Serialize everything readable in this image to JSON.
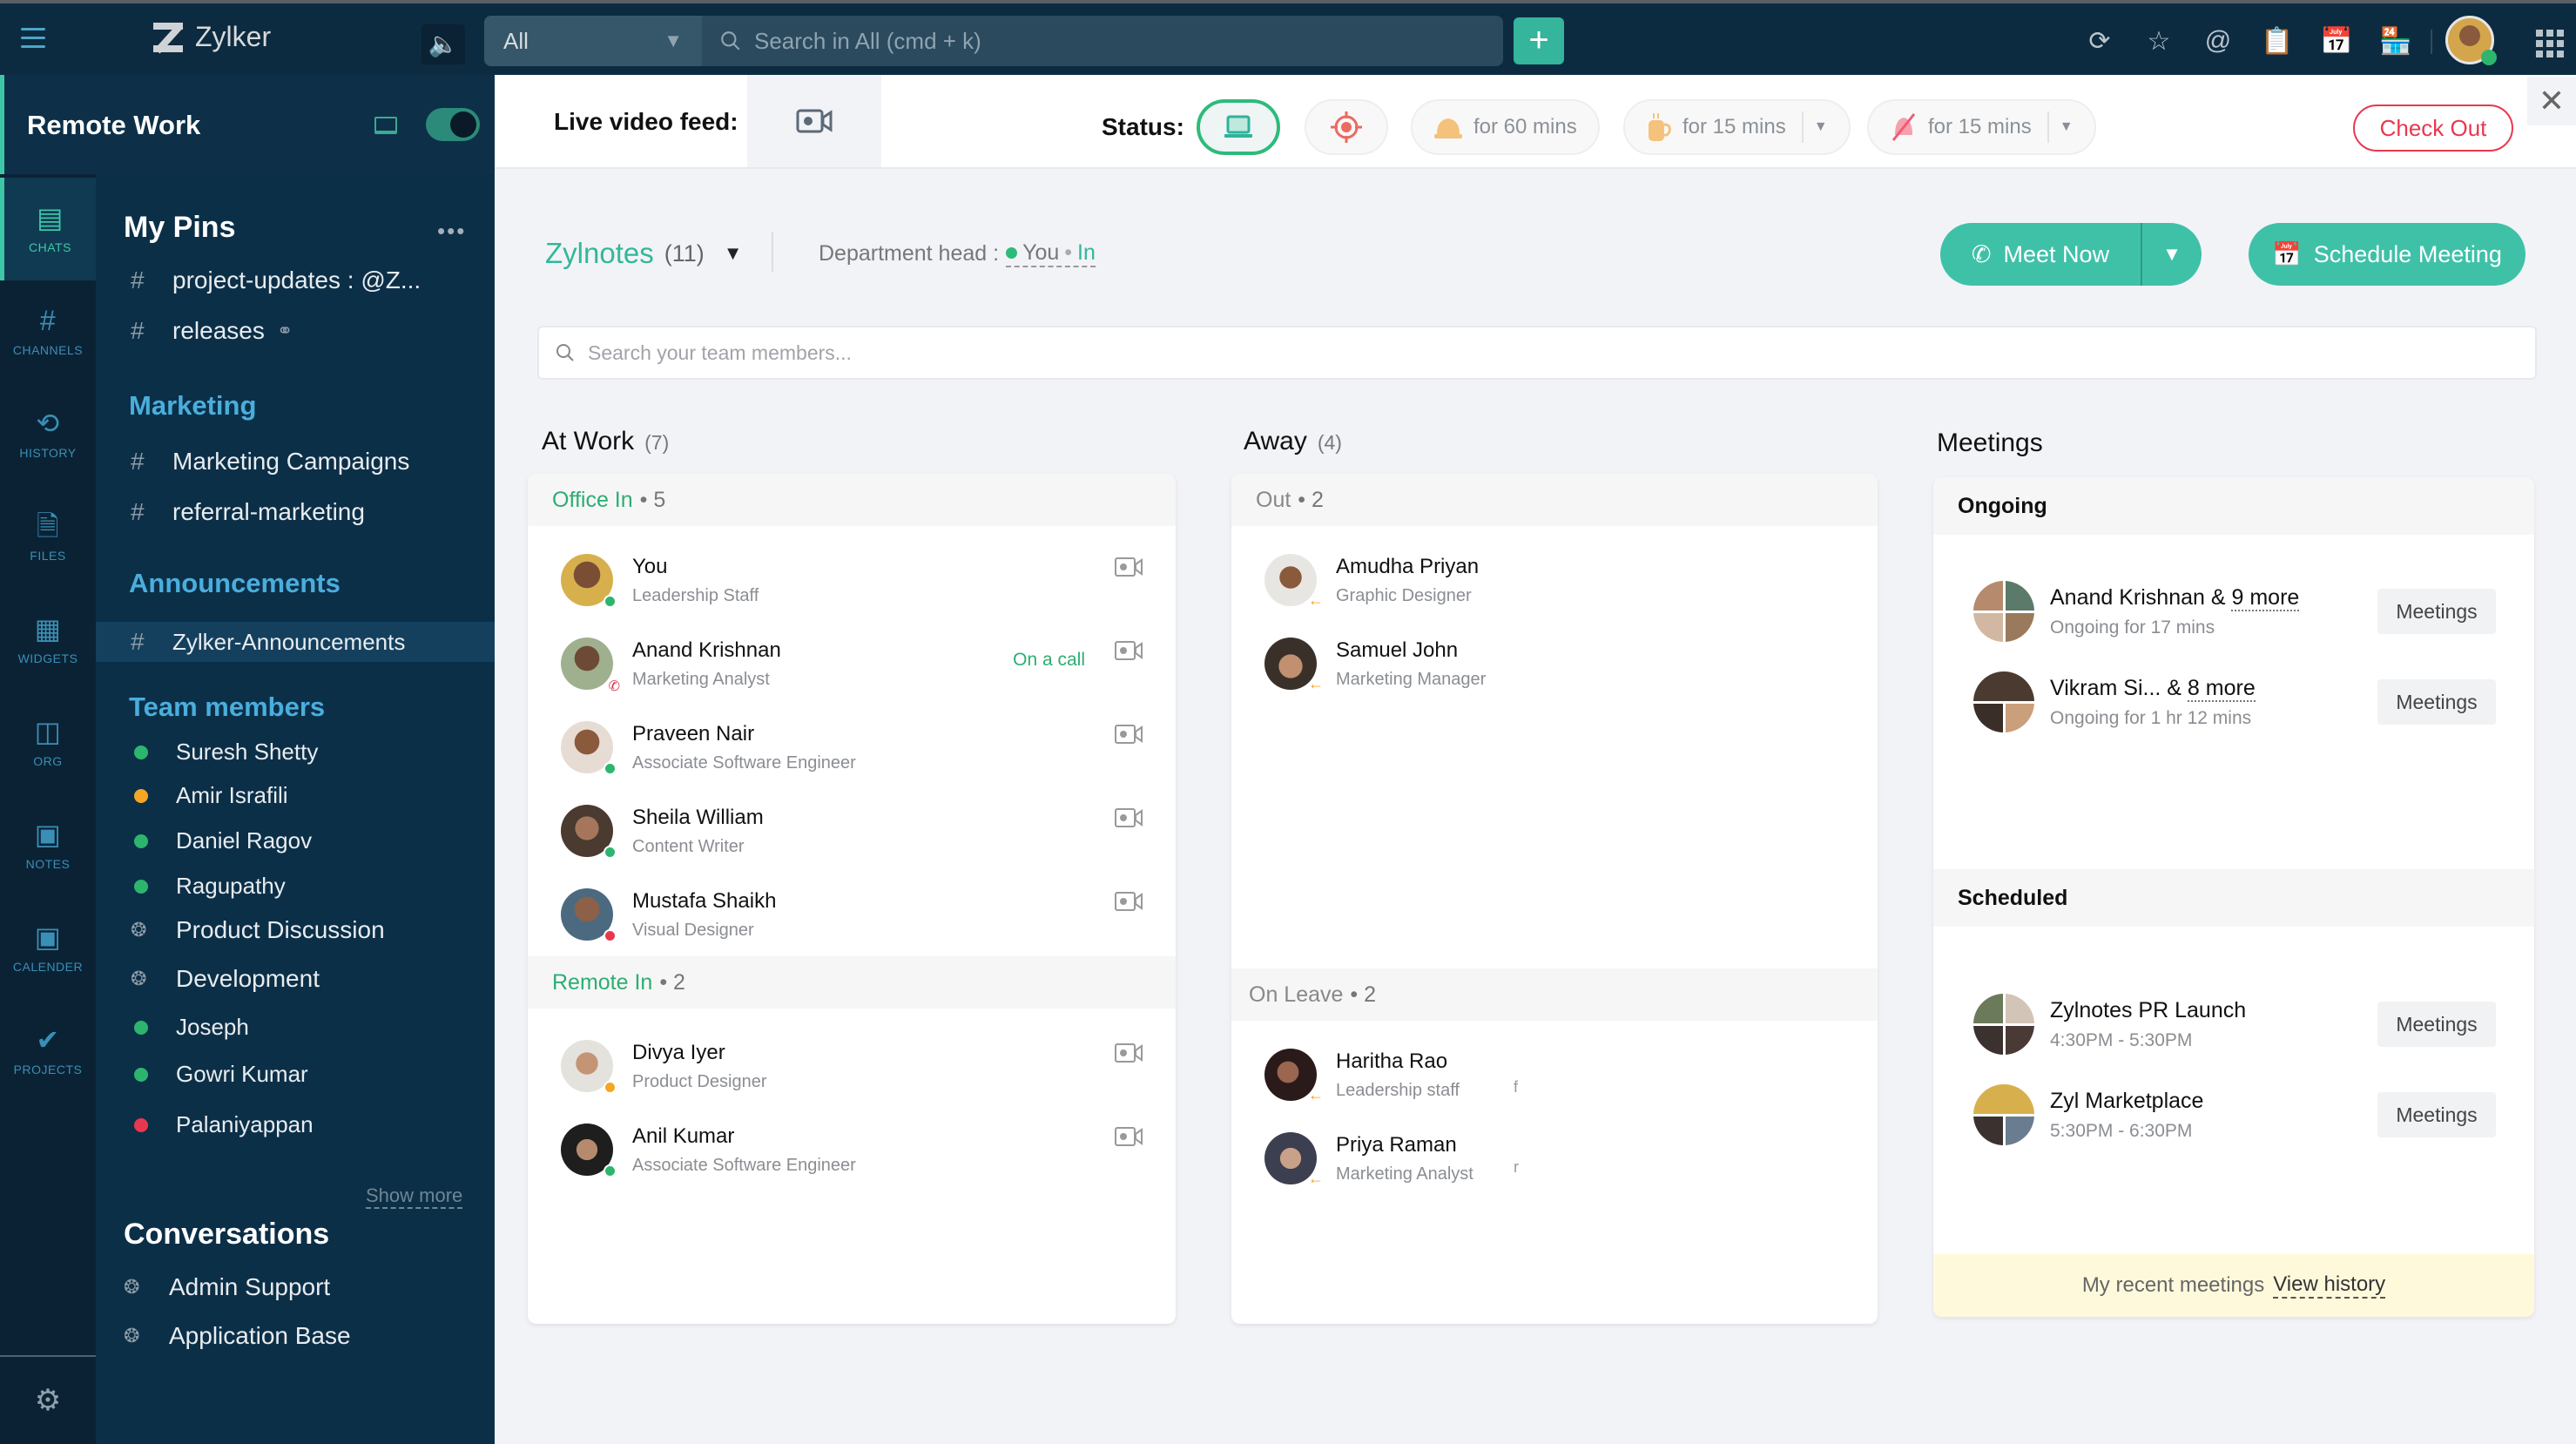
{
  "app": {
    "name": "Zylker",
    "search_scope": "All",
    "search_placeholder": "Search in All (cmd + k)",
    "top_icons": [
      "refresh-clock-icon",
      "star-icon",
      "mention-icon",
      "clipboard-clock-icon",
      "calendar-icon",
      "store-icon"
    ]
  },
  "rail": {
    "header_title": "Remote Work",
    "items": [
      {
        "label": "CHATS",
        "icon": "chat-icon",
        "active": true
      },
      {
        "label": "CHANNELS",
        "icon": "hash-icon"
      },
      {
        "label": "HISTORY",
        "icon": "history-icon"
      },
      {
        "label": "FILES",
        "icon": "file-icon"
      },
      {
        "label": "WIDGETS",
        "icon": "widgets-icon"
      },
      {
        "label": "ORG",
        "icon": "org-icon"
      },
      {
        "label": "NOTES",
        "icon": "notes-icon"
      },
      {
        "label": "CALENDER",
        "icon": "calendar-icon"
      },
      {
        "label": "PROJECTS",
        "icon": "projects-icon"
      }
    ]
  },
  "sidebar": {
    "pins_title": "My Pins",
    "more": "•••",
    "pins": [
      {
        "label": "project-updates : @Z..."
      },
      {
        "label": "releases"
      }
    ],
    "marketing_title": "Marketing",
    "marketing": [
      {
        "label": "Marketing Campaigns"
      },
      {
        "label": "referral-marketing"
      }
    ],
    "announcements_title": "Announcements",
    "announcements": [
      {
        "label": "Zylker-Announcements"
      }
    ],
    "team_title": "Team members",
    "team": [
      {
        "label": "Suresh Shetty",
        "status": "online"
      },
      {
        "label": "Amir Israfili",
        "status": "away"
      },
      {
        "label": "Daniel Ragov",
        "status": "online"
      },
      {
        "label": "Ragupathy",
        "status": "online"
      },
      {
        "label": "Product Discussion",
        "status": "group"
      },
      {
        "label": "Development",
        "status": "group"
      },
      {
        "label": "Joseph",
        "status": "online"
      },
      {
        "label": "Gowri Kumar",
        "status": "online"
      },
      {
        "label": "Palaniyappan",
        "status": "busy"
      }
    ],
    "show_more": "Show more",
    "conversations_title": "Conversations",
    "conversations": [
      {
        "label": "Admin Support"
      },
      {
        "label": "Application Base"
      }
    ]
  },
  "status_bar": {
    "live_video_label": "Live video feed:",
    "status_label": "Status:",
    "chips": [
      {
        "icon": "laptop-icon",
        "label": "",
        "active": true
      },
      {
        "icon": "target-icon",
        "label": ""
      },
      {
        "icon": "bell-icon",
        "label": "for 60 mins"
      },
      {
        "icon": "coffee-icon",
        "label": "for 15 mins",
        "dropdown": true
      },
      {
        "icon": "bell-off-icon",
        "label": "for 15 mins",
        "dropdown": true
      }
    ],
    "checkout_label": "Check Out"
  },
  "team": {
    "name": "Zylnotes",
    "count": "(11)",
    "dept_head_label": "Department head :",
    "dept_head_name": "You",
    "dept_head_status": "In",
    "meet_now_label": "Meet Now",
    "schedule_label": "Schedule Meeting",
    "search_placeholder": "Search your team members..."
  },
  "at_work": {
    "title": "At Work",
    "count": "(7)",
    "office_label": "Office In",
    "office_count": "• 5",
    "office": [
      {
        "name": "You",
        "role": "Leadership Staff",
        "status": "online"
      },
      {
        "name": "Anand Krishnan",
        "role": "Marketing Analyst",
        "status": "call",
        "note": "On a call"
      },
      {
        "name": "Praveen Nair",
        "role": "Associate Software Engineer",
        "status": "online"
      },
      {
        "name": "Sheila William",
        "role": "Content Writer",
        "status": "online"
      },
      {
        "name": "Mustafa Shaikh",
        "role": "Visual Designer",
        "status": "busy"
      }
    ],
    "remote_label": "Remote In",
    "remote_count": "• 2",
    "remote": [
      {
        "name": "Divya Iyer",
        "role": "Product Designer",
        "status": "away"
      },
      {
        "name": "Anil Kumar",
        "role": "Associate Software Engineer",
        "status": "online"
      }
    ]
  },
  "away": {
    "title": "Away",
    "count": "(4)",
    "out_label": "Out",
    "out_count": "• 2",
    "out": [
      {
        "name": "Amudha Priyan",
        "role": "Graphic Designer"
      },
      {
        "name": "Samuel John",
        "role": "Marketing Manager"
      }
    ],
    "leave_label": "On Leave",
    "leave_count": "• 2",
    "leave": [
      {
        "name": "Haritha Rao",
        "role": "Leadership staff",
        "extra": "f"
      },
      {
        "name": "Priya Raman",
        "role": "Marketing Analyst",
        "extra": "r"
      }
    ]
  },
  "meetings": {
    "title": "Meetings",
    "ongoing_label": "Ongoing",
    "ongoing": [
      {
        "title": "Anand Krishnan & ",
        "more": "9 more",
        "sub": "Ongoing for 17 mins",
        "button": "Meetings"
      },
      {
        "title": "Vikram Si... & ",
        "more": "8 more",
        "sub": "Ongoing for 1 hr 12 mins",
        "button": "Meetings"
      }
    ],
    "scheduled_label": "Scheduled",
    "scheduled": [
      {
        "title": "Zylnotes PR Launch",
        "sub": "4:30PM - 5:30PM",
        "button": "Meetings"
      },
      {
        "title": "Zyl Marketplace",
        "sub": "5:30PM - 6:30PM",
        "button": "Meetings"
      }
    ],
    "recent_label": "My recent meetings",
    "view_history": "View history"
  },
  "colors": {
    "accent": "#3fc1a8",
    "online": "#2db56e",
    "away": "#f5a623",
    "busy": "#e8384f",
    "sidebar_bg": "#0c2f48",
    "section_blue": "#4aaedd"
  }
}
